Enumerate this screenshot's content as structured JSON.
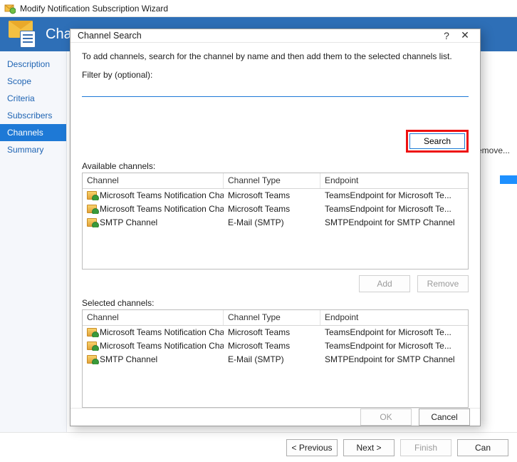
{
  "wizard": {
    "title": "Modify Notification Subscription Wizard",
    "banner": "Cha",
    "nav": [
      "Description",
      "Scope",
      "Criteria",
      "Subscribers",
      "Channels",
      "Summary"
    ],
    "nav_selected": 4,
    "remove_label": "Remove...",
    "footer": {
      "prev": "< Previous",
      "next": "Next >",
      "finish": "Finish",
      "cancel": "Can"
    }
  },
  "dialog": {
    "title": "Channel Search",
    "instructions": "To add channels, search for the channel by name and then add them to the selected channels list.",
    "filter_label": "Filter by (optional):",
    "filter_value": "",
    "search_label": "Search",
    "available_label": "Available channels:",
    "selected_label": "Selected channels:",
    "columns": {
      "c1": "Channel",
      "c2": "Channel Type",
      "c3": "Endpoint"
    },
    "available": [
      {
        "name": "Microsoft Teams Notification Channel",
        "type": "Microsoft Teams",
        "endpoint": "TeamsEndpoint for Microsoft Te..."
      },
      {
        "name": "Microsoft Teams Notification Chann...",
        "type": "Microsoft Teams",
        "endpoint": "TeamsEndpoint for Microsoft Te..."
      },
      {
        "name": "SMTP Channel",
        "type": "E-Mail (SMTP)",
        "endpoint": "SMTPEndpoint for SMTP Channel"
      }
    ],
    "selected": [
      {
        "name": "Microsoft Teams Notification Channel",
        "type": "Microsoft Teams",
        "endpoint": "TeamsEndpoint for Microsoft Te..."
      },
      {
        "name": "Microsoft Teams Notification Chann...",
        "type": "Microsoft Teams",
        "endpoint": "TeamsEndpoint for Microsoft Te..."
      },
      {
        "name": "SMTP Channel",
        "type": "E-Mail (SMTP)",
        "endpoint": "SMTPEndpoint for SMTP Channel"
      }
    ],
    "buttons": {
      "add": "Add",
      "remove": "Remove",
      "ok": "OK",
      "cancel": "Cancel"
    }
  }
}
